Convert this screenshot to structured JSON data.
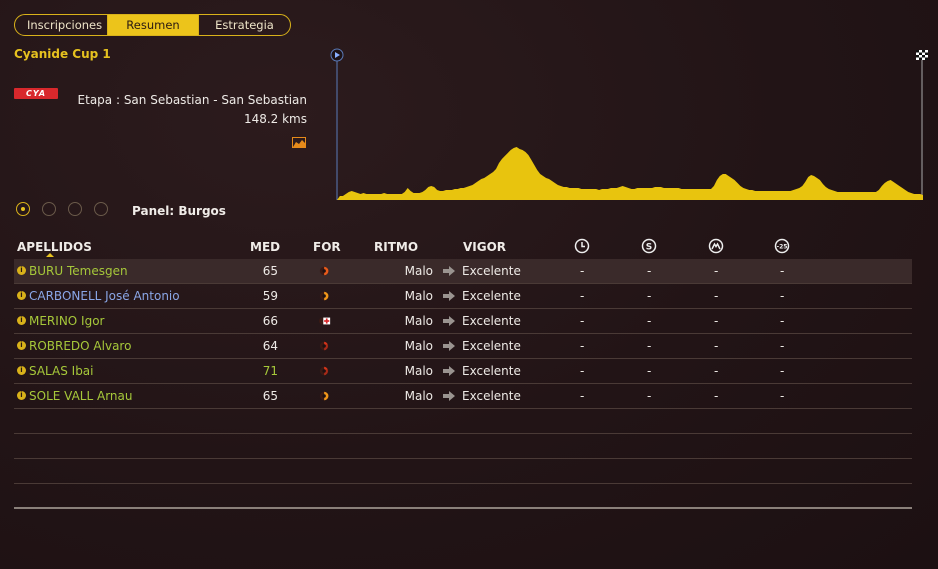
{
  "tabs": [
    {
      "label": "Inscripciones",
      "active": false
    },
    {
      "label": "Resumen",
      "active": true
    },
    {
      "label": "Estrategia",
      "active": false
    }
  ],
  "race": {
    "title": "Cyanide Cup 1",
    "team_logo": "CYA",
    "stage": "Etapa : San Sebastian - San Sebastian",
    "distance": "148.2 kms"
  },
  "panel": {
    "label": "Panel: Burgos",
    "selected_index": 0,
    "count": 4
  },
  "table": {
    "headers": {
      "name": "APELLIDOS",
      "med": "MED",
      "form": "FOR",
      "ritmo": "RITMO",
      "vigor": "VIGOR",
      "icons": [
        "clock-icon",
        "sprint-icon",
        "mountain-icon",
        "minus25-icon"
      ],
      "icon_glyphs": [
        "",
        "S",
        "",
        "-25"
      ]
    },
    "rows": [
      {
        "name": "BURU Temesgen",
        "name_color": "green",
        "med": "65",
        "med_color": "normal",
        "form": "orange-red",
        "ritmo": "Malo",
        "vigor": "Excelente",
        "c1": "-",
        "c2": "-",
        "c3": "-",
        "c4": "-"
      },
      {
        "name": "CARBONELL José Antonio",
        "name_color": "blue",
        "med": "59",
        "med_color": "normal",
        "form": "orange",
        "ritmo": "Malo",
        "vigor": "Excelente",
        "c1": "-",
        "c2": "-",
        "c3": "-",
        "c4": "-"
      },
      {
        "name": "MERINO Igor",
        "name_color": "green",
        "med": "66",
        "med_color": "normal",
        "form": "injury",
        "ritmo": "Malo",
        "vigor": "Excelente",
        "c1": "-",
        "c2": "-",
        "c3": "-",
        "c4": "-"
      },
      {
        "name": "ROBREDO Alvaro",
        "name_color": "green",
        "med": "64",
        "med_color": "normal",
        "form": "red",
        "ritmo": "Malo",
        "vigor": "Excelente",
        "c1": "-",
        "c2": "-",
        "c3": "-",
        "c4": "-"
      },
      {
        "name": "SALAS Ibai",
        "name_color": "green",
        "med": "71",
        "med_color": "green",
        "form": "red",
        "ritmo": "Malo",
        "vigor": "Excelente",
        "c1": "-",
        "c2": "-",
        "c3": "-",
        "c4": "-"
      },
      {
        "name": "SOLE VALL Arnau",
        "name_color": "green",
        "med": "65",
        "med_color": "normal",
        "form": "orange",
        "ritmo": "Malo",
        "vigor": "Excelente",
        "c1": "-",
        "c2": "-",
        "c3": "-",
        "c4": "-"
      }
    ],
    "empty_rows": 4
  },
  "colors": {
    "accent": "#ecc41b",
    "profile_fill": "#e8c40e",
    "name_green": "#a6c83a",
    "name_blue": "#8aa6e6"
  },
  "profile": {
    "points": [
      0,
      4,
      4,
      6,
      8,
      9,
      8,
      7,
      6,
      7,
      6,
      6,
      6,
      6,
      6,
      6,
      7,
      6,
      6,
      6,
      6,
      6,
      6,
      8,
      12,
      9,
      7,
      7,
      7,
      8,
      10,
      13,
      14,
      13,
      10,
      9,
      9,
      10,
      10,
      10,
      11,
      11,
      12,
      12,
      13,
      14,
      15,
      17,
      19,
      21,
      22,
      24,
      26,
      28,
      31,
      37,
      41,
      44,
      47,
      50,
      52,
      53,
      51,
      50,
      48,
      45,
      40,
      35,
      30,
      26,
      24,
      22,
      21,
      19,
      17,
      15,
      14,
      13,
      13,
      12,
      12,
      12,
      12,
      11,
      11,
      11,
      11,
      11,
      11,
      10,
      11,
      11,
      11,
      12,
      12,
      12,
      13,
      14,
      13,
      12,
      11,
      11,
      12,
      12,
      12,
      12,
      12,
      12,
      13,
      13,
      13,
      12,
      12,
      12,
      12,
      12,
      12,
      11,
      11,
      11,
      11,
      11,
      11,
      11,
      11,
      11,
      11,
      11,
      14,
      20,
      24,
      26,
      26,
      24,
      22,
      20,
      17,
      14,
      12,
      11,
      10,
      10,
      9,
      9,
      9,
      9,
      9,
      9,
      9,
      9,
      9,
      9,
      9,
      9,
      9,
      10,
      11,
      12,
      14,
      18,
      23,
      25,
      24,
      22,
      20,
      16,
      13,
      11,
      10,
      9,
      8,
      8,
      8,
      8,
      8,
      8,
      8,
      8,
      8,
      8,
      8,
      8,
      8,
      8,
      10,
      14,
      17,
      19,
      20,
      18,
      16,
      14,
      12,
      10,
      8,
      7,
      6,
      6,
      6,
      5
    ]
  }
}
